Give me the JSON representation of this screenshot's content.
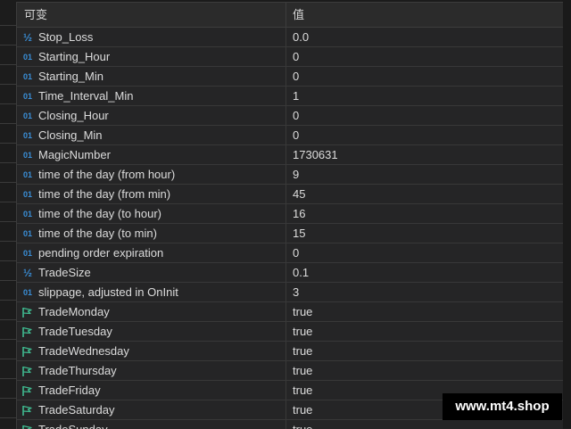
{
  "header": {
    "name_col": "可变",
    "value_col": "值"
  },
  "rows": [
    {
      "icon": "fraction-icon",
      "icon_glyph": "½",
      "name": "Stop_Loss",
      "value": "0.0"
    },
    {
      "icon": "integer-icon",
      "icon_glyph": "01",
      "name": "Starting_Hour",
      "value": "0"
    },
    {
      "icon": "integer-icon",
      "icon_glyph": "01",
      "name": "Starting_Min",
      "value": "0"
    },
    {
      "icon": "integer-icon",
      "icon_glyph": "01",
      "name": "Time_Interval_Min",
      "value": "1"
    },
    {
      "icon": "integer-icon",
      "icon_glyph": "01",
      "name": "Closing_Hour",
      "value": "0"
    },
    {
      "icon": "integer-icon",
      "icon_glyph": "01",
      "name": "Closing_Min",
      "value": "0"
    },
    {
      "icon": "integer-icon",
      "icon_glyph": "01",
      "name": "MagicNumber",
      "value": "1730631"
    },
    {
      "icon": "integer-icon",
      "icon_glyph": "01",
      "name": "time of the day (from hour)",
      "value": "9"
    },
    {
      "icon": "integer-icon",
      "icon_glyph": "01",
      "name": "time of the day (from min)",
      "value": "45"
    },
    {
      "icon": "integer-icon",
      "icon_glyph": "01",
      "name": "time of the day (to hour)",
      "value": "16"
    },
    {
      "icon": "integer-icon",
      "icon_glyph": "01",
      "name": "time of the day (to min)",
      "value": "15"
    },
    {
      "icon": "integer-icon",
      "icon_glyph": "01",
      "name": "pending order expiration",
      "value": "0"
    },
    {
      "icon": "fraction-icon",
      "icon_glyph": "½",
      "name": "TradeSize",
      "value": "0.1"
    },
    {
      "icon": "integer-icon",
      "icon_glyph": "01",
      "name": "slippage, adjusted in OnInit",
      "value": "3"
    },
    {
      "icon": "flag-icon",
      "icon_glyph": "",
      "name": "TradeMonday",
      "value": "true"
    },
    {
      "icon": "flag-icon",
      "icon_glyph": "",
      "name": "TradeTuesday",
      "value": "true"
    },
    {
      "icon": "flag-icon",
      "icon_glyph": "",
      "name": "TradeWednesday",
      "value": "true"
    },
    {
      "icon": "flag-icon",
      "icon_glyph": "",
      "name": "TradeThursday",
      "value": "true"
    },
    {
      "icon": "flag-icon",
      "icon_glyph": "",
      "name": "TradeFriday",
      "value": "true"
    },
    {
      "icon": "flag-icon",
      "icon_glyph": "",
      "name": "TradeSaturday",
      "value": "true"
    },
    {
      "icon": "flag-icon",
      "icon_glyph": "",
      "name": "TradeSunday",
      "value": "true"
    }
  ],
  "watermark": "www.mt4.shop",
  "colors": {
    "background": "#252526",
    "int_icon": "#3a8fd8",
    "flag_icon": "#3fb98f",
    "text": "#dcdcdc"
  }
}
